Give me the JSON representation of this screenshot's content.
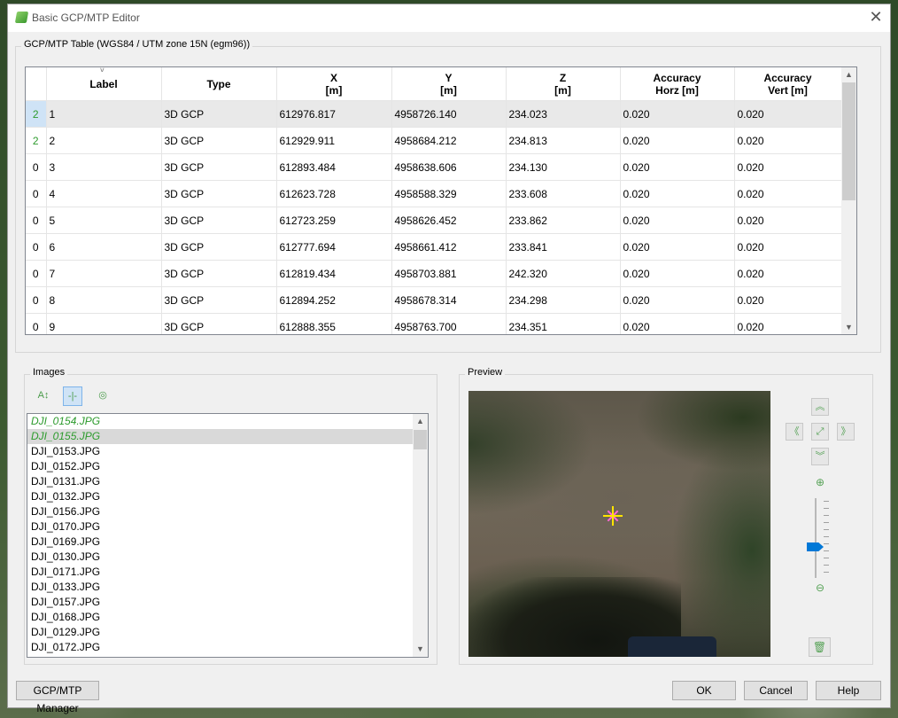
{
  "window": {
    "title": "Basic GCP/MTP Editor"
  },
  "table_group": {
    "label": "GCP/MTP Table (WGS84 / UTM zone 15N (egm96))",
    "headers": [
      {
        "line1": "Label",
        "line2": ""
      },
      {
        "line1": "Type",
        "line2": ""
      },
      {
        "line1": "X",
        "line2": "[m]"
      },
      {
        "line1": "Y",
        "line2": "[m]"
      },
      {
        "line1": "Z",
        "line2": "[m]"
      },
      {
        "line1": "Accuracy",
        "line2": "Horz [m]"
      },
      {
        "line1": "Accuracy",
        "line2": "Vert [m]"
      }
    ],
    "rows": [
      {
        "n": "2",
        "label": "1",
        "type": "3D GCP",
        "x": "612976.817",
        "y": "4958726.140",
        "z": "234.023",
        "ah": "0.020",
        "av": "0.020"
      },
      {
        "n": "2",
        "label": "2",
        "type": "3D GCP",
        "x": "612929.911",
        "y": "4958684.212",
        "z": "234.813",
        "ah": "0.020",
        "av": "0.020"
      },
      {
        "n": "0",
        "label": "3",
        "type": "3D GCP",
        "x": "612893.484",
        "y": "4958638.606",
        "z": "234.130",
        "ah": "0.020",
        "av": "0.020"
      },
      {
        "n": "0",
        "label": "4",
        "type": "3D GCP",
        "x": "612623.728",
        "y": "4958588.329",
        "z": "233.608",
        "ah": "0.020",
        "av": "0.020"
      },
      {
        "n": "0",
        "label": "5",
        "type": "3D GCP",
        "x": "612723.259",
        "y": "4958626.452",
        "z": "233.862",
        "ah": "0.020",
        "av": "0.020"
      },
      {
        "n": "0",
        "label": "6",
        "type": "3D GCP",
        "x": "612777.694",
        "y": "4958661.412",
        "z": "233.841",
        "ah": "0.020",
        "av": "0.020"
      },
      {
        "n": "0",
        "label": "7",
        "type": "3D GCP",
        "x": "612819.434",
        "y": "4958703.881",
        "z": "242.320",
        "ah": "0.020",
        "av": "0.020"
      },
      {
        "n": "0",
        "label": "8",
        "type": "3D GCP",
        "x": "612894.252",
        "y": "4958678.314",
        "z": "234.298",
        "ah": "0.020",
        "av": "0.020"
      },
      {
        "n": "0",
        "label": "9",
        "type": "3D GCP",
        "x": "612888.355",
        "y": "4958763.700",
        "z": "234.351",
        "ah": "0.020",
        "av": "0.020"
      }
    ]
  },
  "images_group": {
    "label": "Images",
    "images": [
      {
        "name": "DJI_0154.JPG",
        "marked": true
      },
      {
        "name": "DJI_0155.JPG",
        "marked": true
      },
      {
        "name": "DJI_0153.JPG",
        "marked": false
      },
      {
        "name": "DJI_0152.JPG",
        "marked": false
      },
      {
        "name": "DJI_0131.JPG",
        "marked": false
      },
      {
        "name": "DJI_0132.JPG",
        "marked": false
      },
      {
        "name": "DJI_0156.JPG",
        "marked": false
      },
      {
        "name": "DJI_0170.JPG",
        "marked": false
      },
      {
        "name": "DJI_0169.JPG",
        "marked": false
      },
      {
        "name": "DJI_0130.JPG",
        "marked": false
      },
      {
        "name": "DJI_0171.JPG",
        "marked": false
      },
      {
        "name": "DJI_0133.JPG",
        "marked": false
      },
      {
        "name": "DJI_0157.JPG",
        "marked": false
      },
      {
        "name": "DJI_0168.JPG",
        "marked": false
      },
      {
        "name": "DJI_0129.JPG",
        "marked": false
      },
      {
        "name": "DJI_0172.JPG",
        "marked": false
      }
    ],
    "selected_index": 1
  },
  "preview_group": {
    "label": "Preview"
  },
  "buttons": {
    "manager": "GCP/MTP Manager",
    "ok": "OK",
    "cancel": "Cancel",
    "help": "Help"
  },
  "colors": {
    "marked_text": "#2d9b2d",
    "selection": "#cfe3f6",
    "accent": "#0078d7"
  }
}
